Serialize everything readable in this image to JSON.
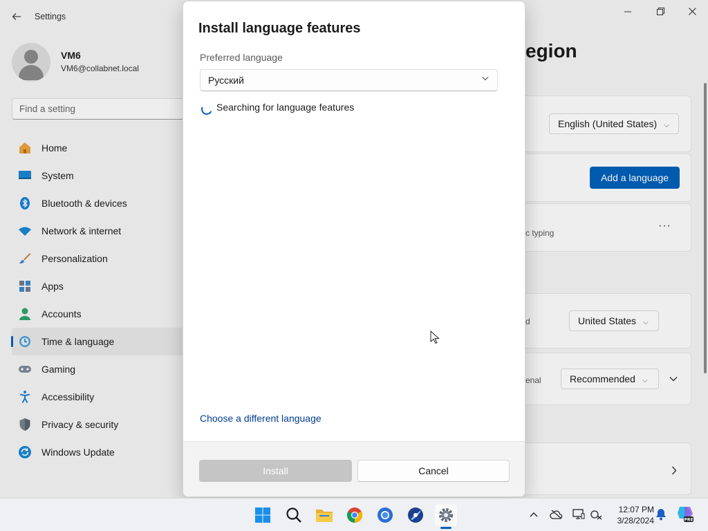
{
  "window": {
    "title": "Settings",
    "back_icon": "arrow-left-icon",
    "controls": [
      "minimize-icon",
      "maximize-icon",
      "close-icon"
    ]
  },
  "profile": {
    "name": "VM6",
    "email": "VM6@collabnet.local"
  },
  "search": {
    "placeholder": "Find a setting"
  },
  "sidebar": {
    "items": [
      {
        "label": "Home",
        "icon": "home-icon"
      },
      {
        "label": "System",
        "icon": "system-icon"
      },
      {
        "label": "Bluetooth & devices",
        "icon": "bluetooth-icon"
      },
      {
        "label": "Network & internet",
        "icon": "wifi-icon"
      },
      {
        "label": "Personalization",
        "icon": "brush-icon"
      },
      {
        "label": "Apps",
        "icon": "apps-icon"
      },
      {
        "label": "Accounts",
        "icon": "accounts-icon"
      },
      {
        "label": "Time & language",
        "icon": "clock-globe-icon",
        "active": true
      },
      {
        "label": "Gaming",
        "icon": "gamepad-icon"
      },
      {
        "label": "Accessibility",
        "icon": "accessibility-icon"
      },
      {
        "label": "Privacy & security",
        "icon": "shield-icon"
      },
      {
        "label": "Windows Update",
        "icon": "update-icon"
      }
    ]
  },
  "main": {
    "heading_partial": "egion",
    "display_language_value": "English (United States)",
    "add_language_label": "Add a language",
    "typing_partial": "c typing",
    "more_label": "···",
    "country_partial": "d",
    "country_value": "United States",
    "format_partial": "enal",
    "format_value": "Recommended"
  },
  "dialog": {
    "title": "Install language features",
    "preferred_label": "Preferred language",
    "preferred_value": "Русский",
    "status": "Searching for language features",
    "link": "Choose a different language",
    "install_label": "Install",
    "cancel_label": "Cancel"
  },
  "taskbar": {
    "apps": [
      "windows-start-icon",
      "search-icon",
      "file-explorer-icon",
      "chrome-icon",
      "chrome-alt-icon",
      "browser-icon",
      "settings-icon"
    ],
    "active_app": "settings-icon",
    "tray_icons": [
      "chevron-up-icon",
      "cloud-off-icon",
      "display-icon",
      "network-icon",
      "notification-bell-icon",
      "copilot-pre-icon"
    ],
    "time": "12:07 PM",
    "date": "3/28/2024"
  }
}
